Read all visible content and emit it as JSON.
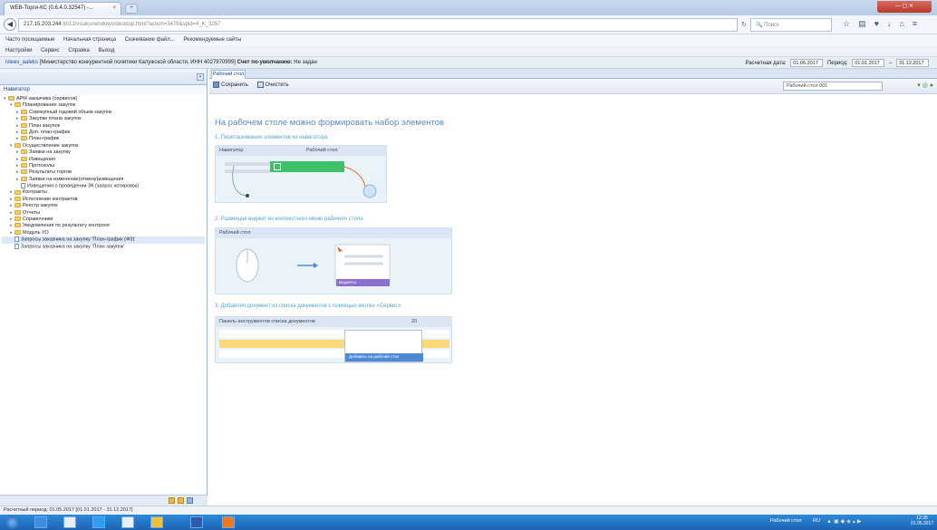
{
  "browser": {
    "tab_title": "WEB-Торги-КС (0.6.4.0.32547) -...",
    "tab_close": "×",
    "new_tab": "+",
    "url_host": "217.15.203.244",
    "url_rest": ":8013/vsiaks/windows/desktop.html?action=3478&spid=4_K_3267",
    "search_placeholder": "Поиск",
    "window_controls": "— ▢ ✕",
    "bookmarks": [
      "Часто посещаемые",
      "Начальная страница",
      "Скачивание файл...",
      "Рекомендуемые сайты"
    ],
    "bookmarks2": [
      "Настройки",
      "Сервис",
      "Справка",
      "Выход"
    ]
  },
  "app_header": {
    "user": "ivleev_aaleks",
    "org": "[Министерство конкурентной политики Калужской области, ИНН 4027970999]",
    "role_label": "Счет по-умолчанию:",
    "role_value": "Не задан",
    "period_label": "Расчетная дата:",
    "period_date": "01.05.2017",
    "range_label": "Период:",
    "range_from": "01.01.2017",
    "range_to": "31.12.2017"
  },
  "left_panel": {
    "title": "Навигатор",
    "tree": [
      {
        "label": "АРМ заказчика (сервисов)",
        "level": 0,
        "type": "folder",
        "expanded": true
      },
      {
        "label": "Планирование закупок",
        "level": 1,
        "type": "folder",
        "expanded": true
      },
      {
        "label": "Совокупный годовой объем закупок",
        "level": 2,
        "type": "folder"
      },
      {
        "label": "Закупки плана закупок",
        "level": 2,
        "type": "folder"
      },
      {
        "label": "План закупок",
        "level": 2,
        "type": "folder"
      },
      {
        "label": "Доп. план-график",
        "level": 2,
        "type": "folder"
      },
      {
        "label": "План-график",
        "level": 2,
        "type": "folder"
      },
      {
        "label": "Осуществление закупок",
        "level": 1,
        "type": "folder",
        "expanded": true
      },
      {
        "label": "Заявки на закупку",
        "level": 2,
        "type": "folder"
      },
      {
        "label": "Извещения",
        "level": 2,
        "type": "folder"
      },
      {
        "label": "Протоколы",
        "level": 2,
        "type": "folder"
      },
      {
        "label": "Результаты торгов",
        "level": 2,
        "type": "folder"
      },
      {
        "label": "Заявки на изменение(отмену)извещения",
        "level": 2,
        "type": "folder"
      },
      {
        "label": "Извещения о проведении ЗК (запрос котировок)",
        "level": 2,
        "type": "doc"
      },
      {
        "label": "Контракты",
        "level": 1,
        "type": "folder"
      },
      {
        "label": "Исполнение контрактов",
        "level": 1,
        "type": "folder"
      },
      {
        "label": "Реестр закупок",
        "level": 1,
        "type": "folder"
      },
      {
        "label": "Отчеты",
        "level": 1,
        "type": "folder"
      },
      {
        "label": "Справочники",
        "level": 1,
        "type": "folder"
      },
      {
        "label": "Уведомления по результату контроля",
        "level": 1,
        "type": "folder"
      },
      {
        "label": "Модуль УО",
        "level": 1,
        "type": "folder"
      },
      {
        "label": "Запросы заказчика на закупку 'План-график (ФЗ)'",
        "level": 1,
        "type": "doc",
        "selected": true
      },
      {
        "label": "Запросы заказчика на закупку 'План закупок'",
        "level": 1,
        "type": "doc"
      }
    ]
  },
  "right_panel": {
    "tab": "Рабочий стол",
    "toolbar": {
      "save": "Сохранить",
      "clear": "Очистить",
      "select": "Рабочий стол 001"
    },
    "heading": "На рабочем столе можно формировать набор элементов",
    "step1": "1. Перетаскивание элементов из навигатора",
    "step1_cols": [
      "Навигатор",
      "Рабочий стол"
    ],
    "step2": "2. Размещая виджет из контекстного меню рабочего стола",
    "step2_hdr": "Рабочий стол",
    "step2_menu_item": "Виджеты",
    "step3": "3. Добавляя документ из списка документов с помощью кнопки «Сервис»",
    "step3_hdr": "Панель инструментов списка документов",
    "step3_btn": "Добавить на рабочий стол",
    "step3_count": "20"
  },
  "status_bar": {
    "text": "Расчетный период: 01.05.2017 [01.01.2017 - 31.12.2017]"
  },
  "taskbar": {
    "desktop_label": "Рабочий стол",
    "lang": "RU",
    "time": "12:35",
    "date": "01.05.2017"
  },
  "colors": {
    "accent": "#15428b",
    "heading": "#5b87c4",
    "step": "#56a5c9",
    "green": "#3fbf6a",
    "purple": "#8c6fd0",
    "taskbar": "#1e73c8"
  }
}
